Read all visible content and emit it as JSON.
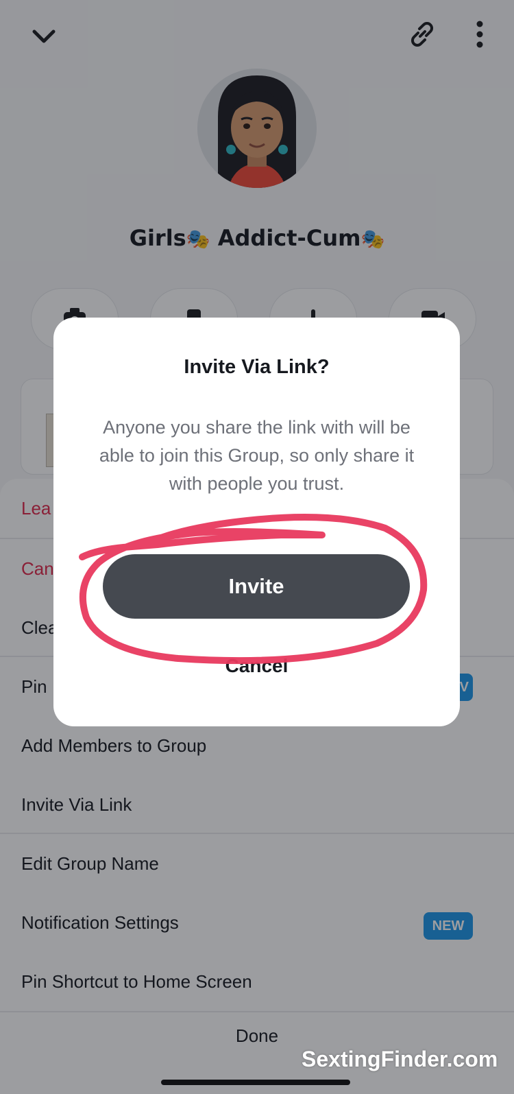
{
  "group": {
    "name": "Girls",
    "name_mid": " Addict-Cum",
    "mask_emoji": "🎭"
  },
  "icons": {
    "back": "chevron-down-icon",
    "link": "link-icon",
    "more": "more-vertical-icon",
    "camera": "camera-icon",
    "chat": "chat-icon",
    "call": "phone-icon",
    "video": "video-icon"
  },
  "sheet": {
    "items": [
      {
        "label": "Leave Group",
        "visible": "Lea",
        "style": "red"
      },
      {
        "label": "Cancel",
        "visible": "Can",
        "style": "red"
      },
      {
        "label": "Clear",
        "visible": "Clea",
        "style": "normal"
      },
      {
        "label": "Pin",
        "visible": "Pin",
        "style": "normal"
      },
      {
        "label": "Add Members to Group",
        "visible": "Add Members to Group",
        "style": "normal"
      },
      {
        "label": "Invite Via Link",
        "visible": "Invite Via Link",
        "style": "normal"
      },
      {
        "label": "Edit Group Name",
        "visible": "Edit Group Name",
        "style": "normal"
      },
      {
        "label": "Notification Settings",
        "visible": "Notification Settings",
        "style": "normal"
      },
      {
        "label": "Pin Shortcut to Home Screen",
        "visible": "Pin Shortcut to Home Screen",
        "style": "normal"
      }
    ],
    "badge_new": "NEW",
    "badge_new_partial": "V",
    "done": "Done"
  },
  "modal": {
    "title": "Invite Via Link?",
    "body": "Anyone you share the link with will be able to join this Group, so only share it with people you trust.",
    "invite": "Invite",
    "cancel": "Cancel"
  },
  "watermark": "SextingFinder.com",
  "colors": {
    "accent_red": "#e0284a",
    "badge_blue": "#1d97e8",
    "button_dark": "#454950",
    "highlight_pink": "#e8395e"
  }
}
